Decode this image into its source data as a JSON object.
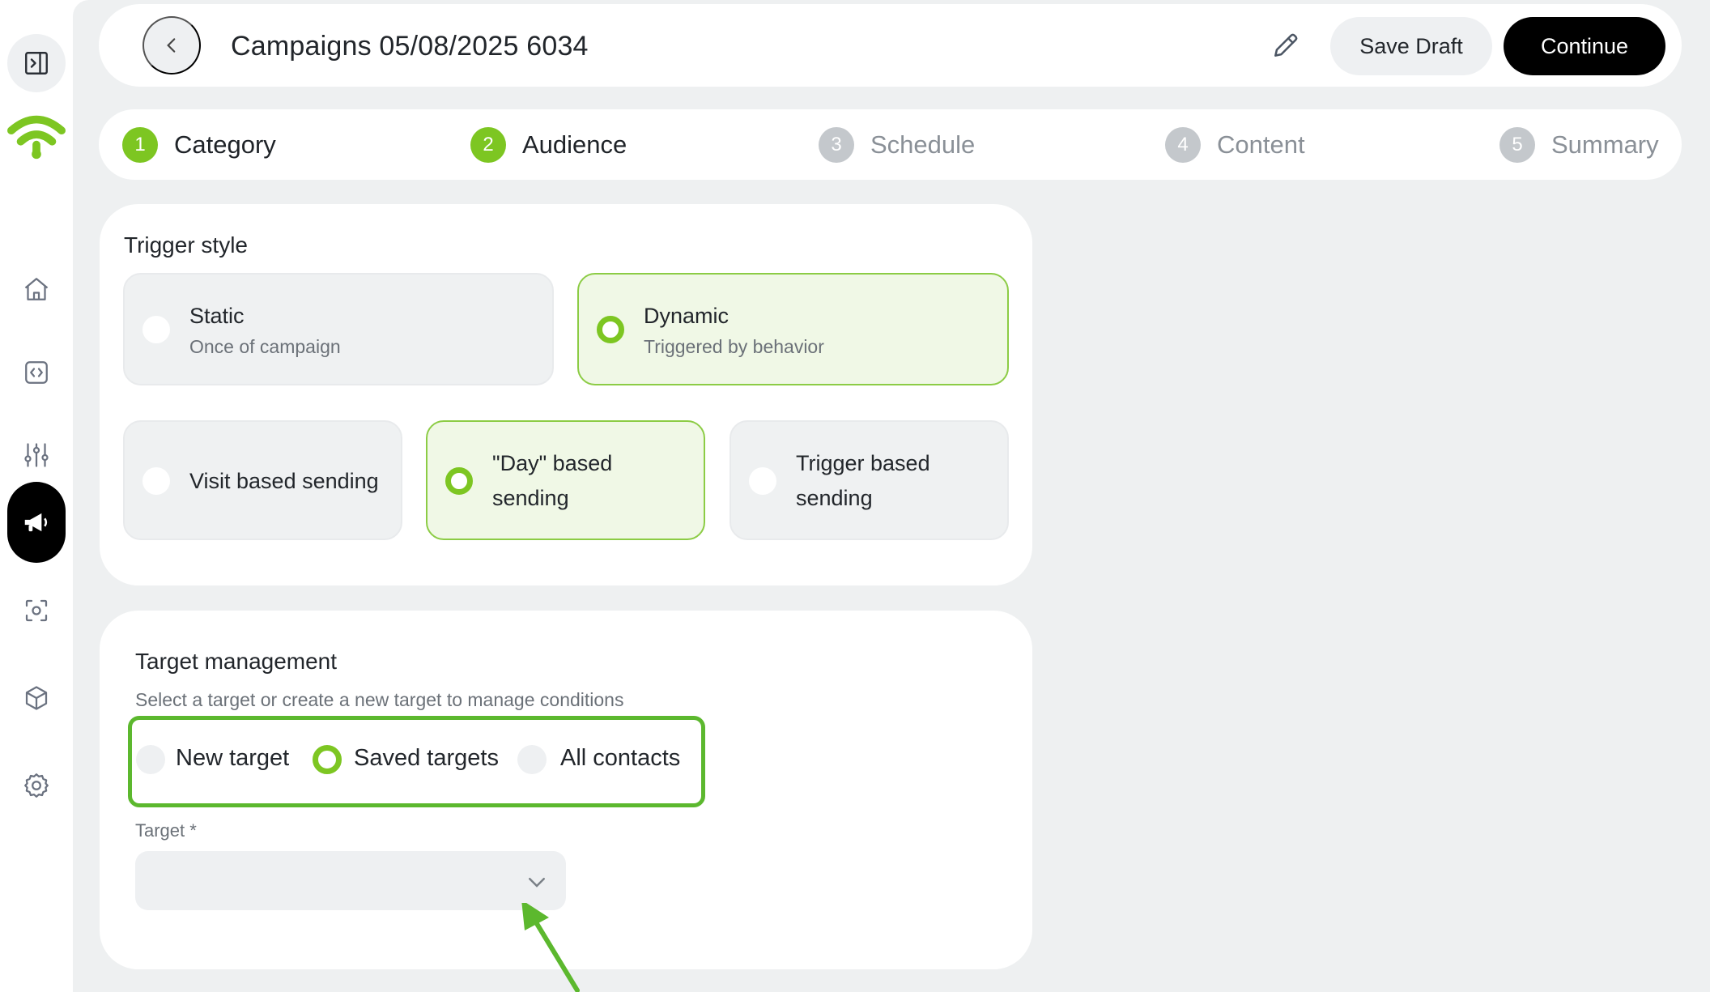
{
  "sidebar": {
    "icons": [
      "panel-toggle-icon",
      "wifi-logo-icon",
      "home-icon",
      "code-icon",
      "sliders-icon",
      "megaphone-icon",
      "scan-icon",
      "cube-icon",
      "gear-icon"
    ],
    "active": "megaphone-icon",
    "brand_color": "#7dc622"
  },
  "header": {
    "title": "Campaigns 05/08/2025 6034",
    "save_draft_label": "Save Draft",
    "continue_label": "Continue"
  },
  "stepper": {
    "steps": [
      {
        "number": "1",
        "label": "Category",
        "state": "done"
      },
      {
        "number": "2",
        "label": "Audience",
        "state": "done"
      },
      {
        "number": "3",
        "label": "Schedule",
        "state": "todo"
      },
      {
        "number": "4",
        "label": "Content",
        "state": "todo"
      },
      {
        "number": "5",
        "label": "Summary",
        "state": "todo"
      }
    ]
  },
  "trigger_style": {
    "title": "Trigger style",
    "options": [
      {
        "title": "Static",
        "subtitle": "Once of campaign",
        "selected": false
      },
      {
        "title": "Dynamic",
        "subtitle": "Triggered by behavior",
        "selected": true
      }
    ],
    "sending": [
      {
        "label": "Visit based sending",
        "selected": false
      },
      {
        "label": "\"Day\" based sending",
        "selected": true
      },
      {
        "label": "Trigger based sending",
        "selected": false
      }
    ]
  },
  "target_management": {
    "title": "Target management",
    "subtitle": "Select a target or create a new target to manage conditions",
    "options": [
      {
        "label": "New target",
        "selected": false
      },
      {
        "label": "Saved targets",
        "selected": true
      },
      {
        "label": "All contacts",
        "selected": false
      }
    ],
    "target_field_label": "Target *",
    "target_value": ""
  },
  "colors": {
    "accent": "#7dc622",
    "highlight": "#5cb82e",
    "background": "#eef0f1"
  }
}
